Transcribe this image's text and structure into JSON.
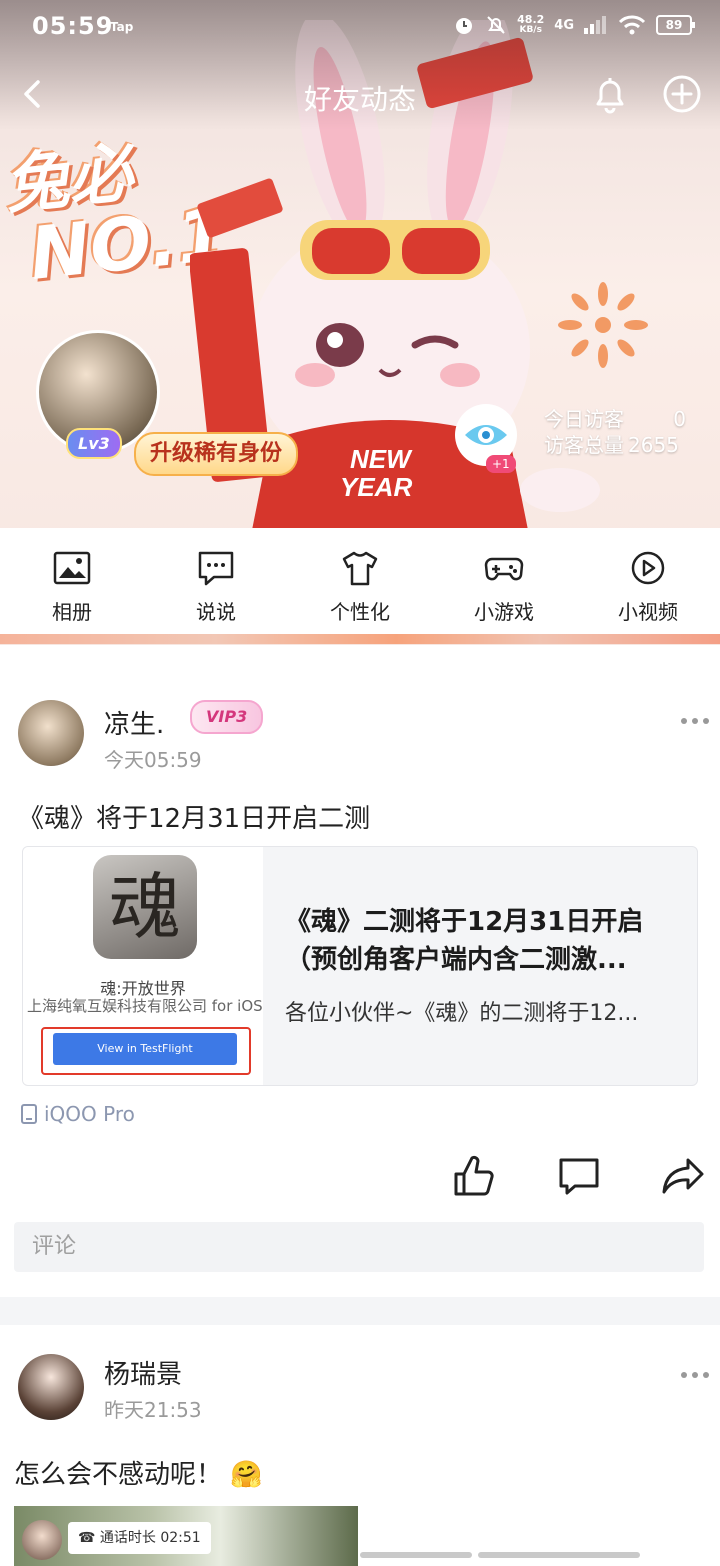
{
  "status": {
    "time": "05:59",
    "tap": "Tap",
    "net_speed": "48.2",
    "net_unit": "KB/s",
    "signal": "4G",
    "battery": "89"
  },
  "nav": {
    "title": "好友动态"
  },
  "banner": {
    "art_line1": "兔必",
    "art_line2": "NO.1",
    "shirt_text": "NEW YEAR"
  },
  "profile": {
    "level": "Lv3",
    "upgrade_label": "升级稀有身份",
    "visitor_badge": "+1",
    "today_label": "今日访客",
    "today_value": "0",
    "total_label": "访客总量",
    "total_value": "2655"
  },
  "menu": [
    {
      "label": "相册",
      "icon": "album-icon"
    },
    {
      "label": "说说",
      "icon": "chat-bubble-icon"
    },
    {
      "label": "个性化",
      "icon": "tshirt-icon"
    },
    {
      "label": "小游戏",
      "icon": "gamepad-icon"
    },
    {
      "label": "小视频",
      "icon": "play-icon"
    }
  ],
  "posts": [
    {
      "name": "凉生.",
      "vip": "VIP3",
      "time": "今天05:59",
      "text": "《魂》将于12月31日开启二测",
      "card": {
        "app_icon_char": "魂",
        "app_name": "魂:开放世界",
        "app_developer": "上海纯氧互娱科技有限公司 for iOS",
        "button": "View in TestFlight",
        "title": "《魂》二测将于12月31日开启（预创角客户端内含二测激...",
        "desc": "各位小伙伴~《魂》的二测将于12..."
      },
      "device": "iQOO Pro",
      "comment_placeholder": "评论"
    },
    {
      "name": "杨瑞景",
      "time": "昨天21:53",
      "text": "怎么会不感动呢！",
      "emoji": "🤗",
      "call_label": "通话时长",
      "call_duration": "02:51"
    }
  ],
  "colors": {
    "accent_red": "#e23a2a",
    "tf_blue": "#3d79e6",
    "vip_pink": "#d4377c",
    "muted": "#9a9a9a",
    "device": "#8c97b0"
  }
}
